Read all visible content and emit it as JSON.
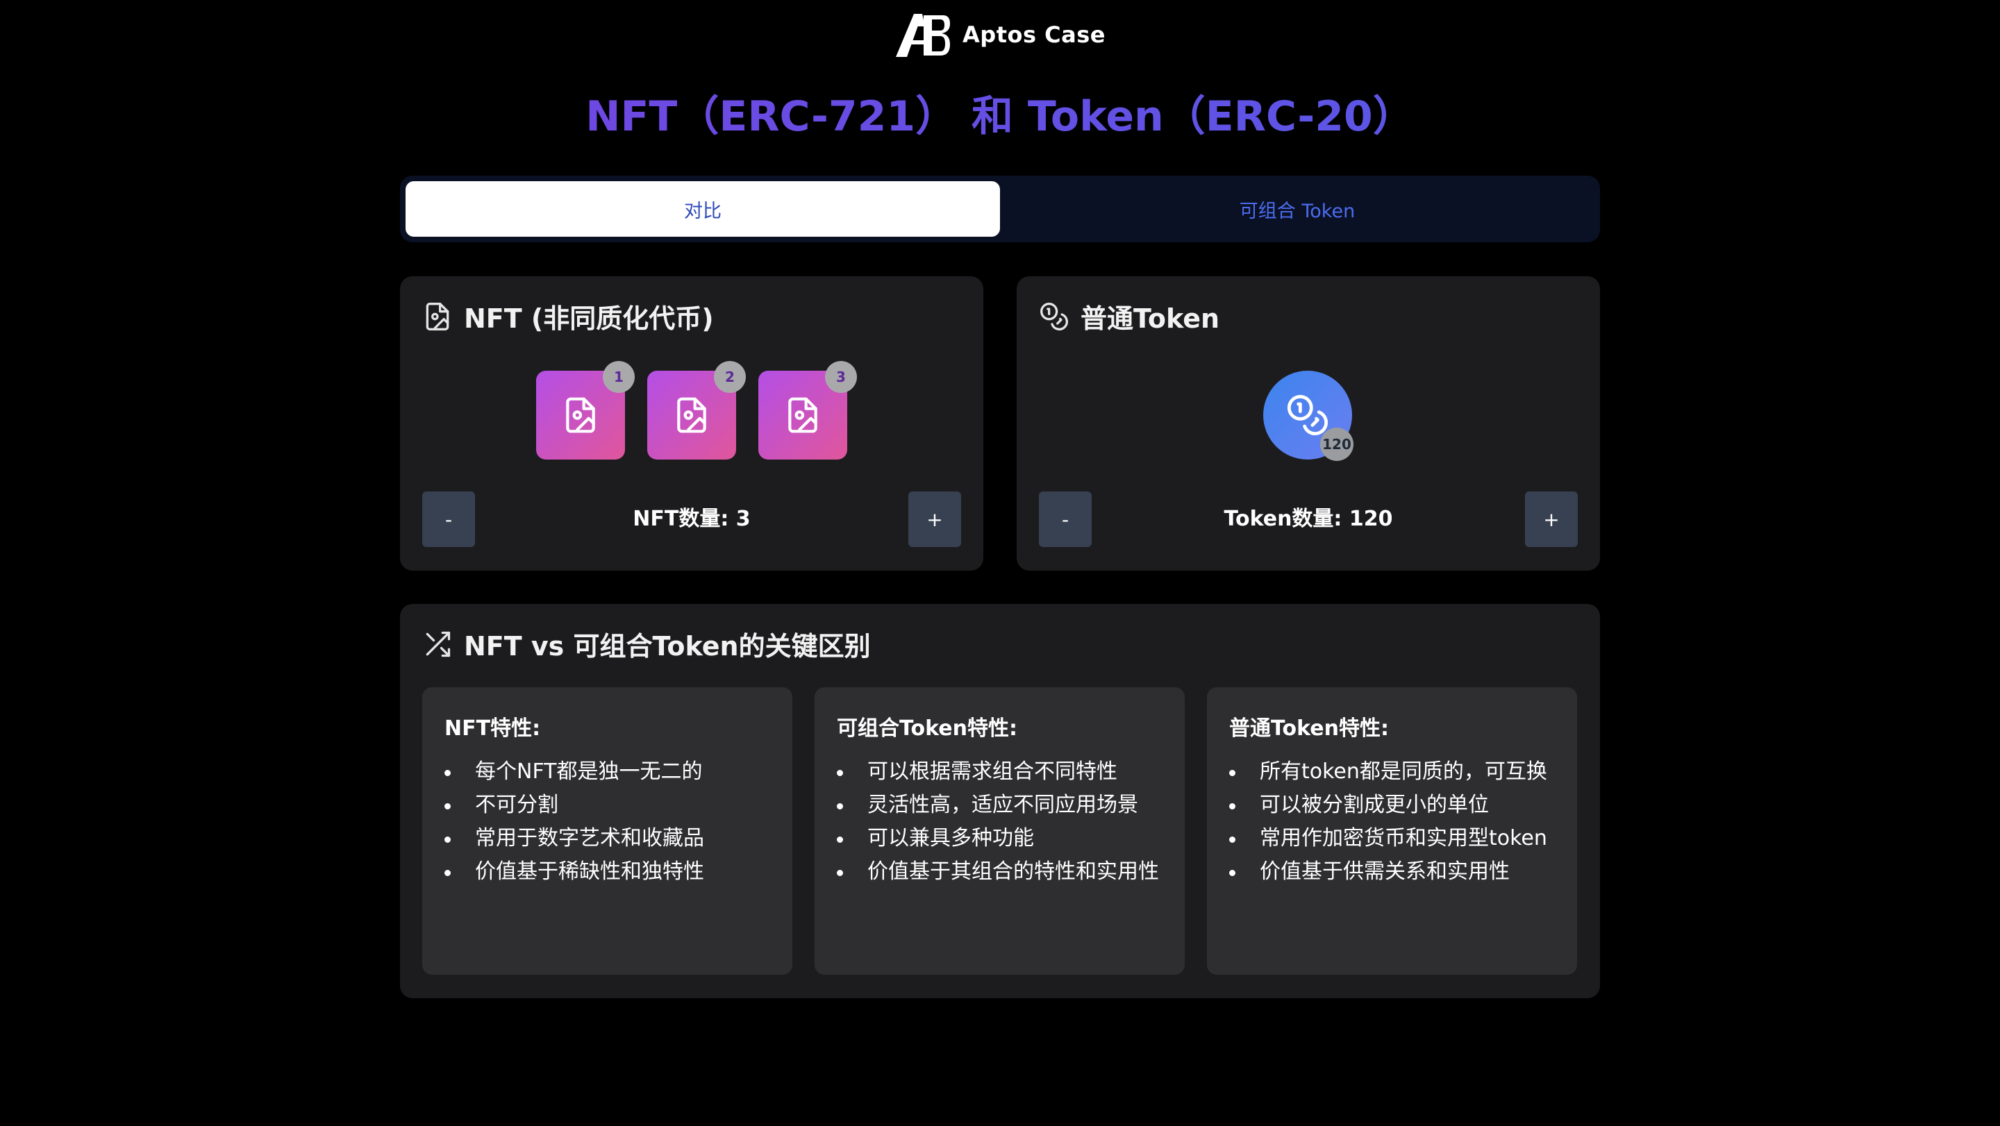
{
  "header": {
    "brand": "Aptos Case",
    "logo_icon": "aptos-case-logo"
  },
  "title": "NFT（ERC-721） 和 Token（ERC-20）",
  "tabs": [
    {
      "label": "对比",
      "active": true
    },
    {
      "label": "可组合 Token",
      "active": false
    }
  ],
  "nft_card": {
    "title": "NFT (非同质化代币)",
    "icon": "image-file-icon",
    "tiles": [
      {
        "badge": "1"
      },
      {
        "badge": "2"
      },
      {
        "badge": "3"
      }
    ],
    "minus_label": "-",
    "plus_label": "+",
    "count_label": "NFT数量: 3"
  },
  "token_card": {
    "title": "普通Token",
    "icon": "coins-icon",
    "badge": "120",
    "minus_label": "-",
    "plus_label": "+",
    "count_label": "Token数量: 120"
  },
  "diff_card": {
    "title": "NFT vs 可组合Token的关键区别",
    "icon": "shuffle-icon",
    "panels": [
      {
        "title": "NFT特性:",
        "items": [
          "每个NFT都是独一无二的",
          "不可分割",
          "常用于数字艺术和收藏品",
          "价值基于稀缺性和独特性"
        ]
      },
      {
        "title": "可组合Token特性:",
        "items": [
          "可以根据需求组合不同特性",
          "灵活性高，适应不同应用场景",
          "可以兼具多种功能",
          "价值基于其组合的特性和实用性"
        ]
      },
      {
        "title": "普通Token特性:",
        "items": [
          "所有token都是同质的，可互换",
          "可以被分割成更小的单位",
          "常用作加密货币和实用型token",
          "价值基于供需关系和实用性"
        ]
      }
    ]
  },
  "colors": {
    "background": "#000000",
    "title_gradient_start": "#7a3fe0",
    "title_gradient_end": "#4f5fe8",
    "card": "#1c1c1e",
    "panel": "#2e2e30",
    "tab_bar": "#0b1124",
    "tab_text": "#4b6cf0",
    "nft_tile_start": "#b44fe6",
    "nft_tile_end": "#e0569b",
    "coin_start": "#3c84ee",
    "button": "#374151"
  }
}
